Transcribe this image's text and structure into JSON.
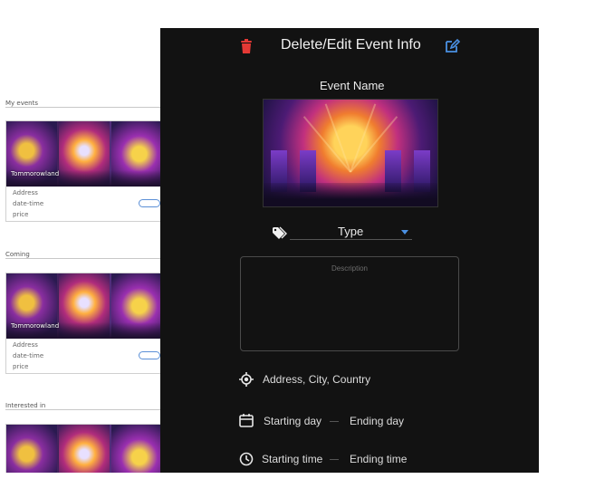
{
  "background": {
    "sections": [
      {
        "label": "My events"
      },
      {
        "label": "Coming"
      },
      {
        "label": "Interested in"
      }
    ],
    "card": {
      "title": "Tommorowland",
      "address": "Address",
      "datetime": "date-time",
      "price": "price"
    }
  },
  "panel": {
    "title": "Delete/Edit Event Info",
    "event_name": "Event Name",
    "type_label": "Type",
    "description_placeholder": "Description",
    "address": "Address, City, Country",
    "starting_day": "Starting day",
    "ending_day": "Ending day",
    "starting_time": "Starting time",
    "ending_time": "Ending time",
    "colors": {
      "background": "#121212",
      "accent_blue": "#4a90e2",
      "delete_red": "#e53935"
    },
    "icons": [
      "trash-icon",
      "edit-icon",
      "tag-icon",
      "location-icon",
      "calendar-icon",
      "clock-icon",
      "caret-down-icon"
    ]
  }
}
